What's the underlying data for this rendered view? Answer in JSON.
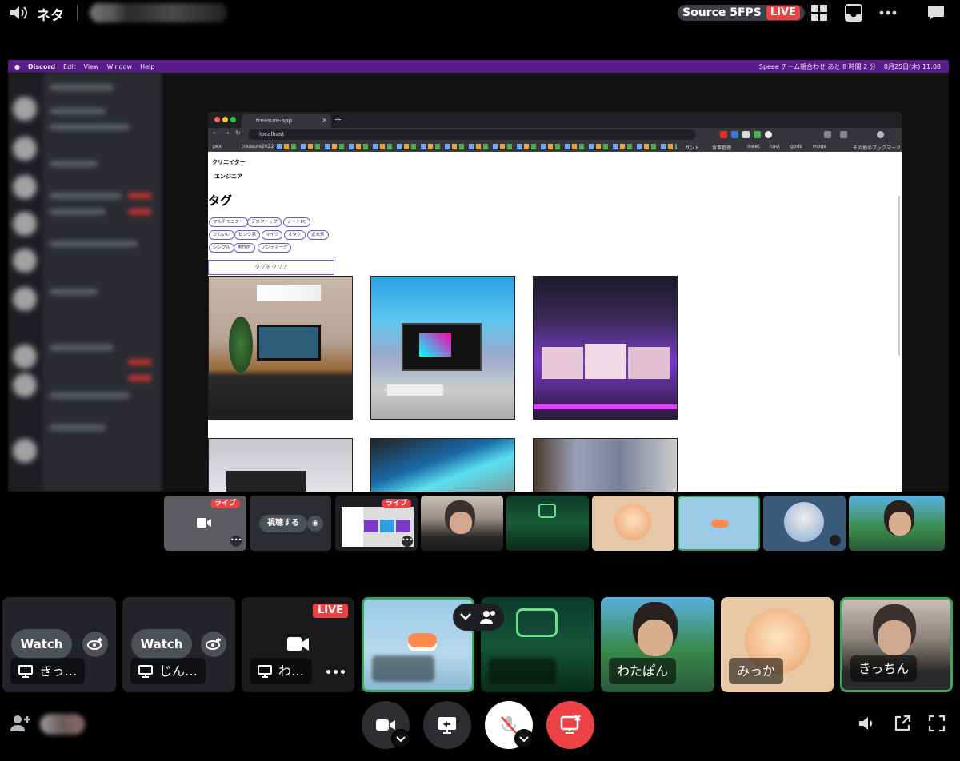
{
  "topbar": {
    "channel": "ネタ",
    "stream_quality": "Source 5FPS",
    "live_label": "LIVE"
  },
  "mac_menu": {
    "items": [
      "Discord",
      "Edit",
      "View",
      "Window",
      "Help"
    ],
    "status": "Speee チーム親合わせ あと 8 時間 2 分",
    "datetime": "8月25日(木) 11:08"
  },
  "browser": {
    "tab_title": "treasure-app",
    "url": "localhost",
    "bookmarks": [
      "pex",
      "treasure2022",
      "ガント",
      "食事管理",
      "meet",
      "navi",
      "gods",
      "mogs",
      "その他のブックマーク"
    ],
    "page": {
      "roles": [
        "クリエイター",
        "エンジニア"
      ],
      "tag_heading": "タグ",
      "tags": [
        [
          "マルチモニター",
          "デスクトップ",
          "ノートPC"
        ],
        [
          "かわいい",
          "ピンク系",
          "マイク",
          "オタク",
          "近未来"
        ],
        [
          "シンプル",
          "男性的",
          "アンティーク"
        ]
      ],
      "clear_button": "タグをクリア"
    }
  },
  "strip": {
    "live_label": "ライブ",
    "watch_label": "視聴する"
  },
  "tiles": [
    {
      "watch": "Watch",
      "name": "きっ…"
    },
    {
      "watch": "Watch",
      "name": "じん…"
    },
    {
      "live": "LIVE",
      "name": "わ…"
    },
    {
      "name": ""
    },
    {
      "name": ""
    },
    {
      "name": "わたぽん"
    },
    {
      "name": "みっか"
    },
    {
      "name": "きっちん"
    }
  ],
  "colors": {
    "live_red": "#ed4245",
    "speaking_green": "#3ba55d",
    "hangup_red": "#ed4245"
  }
}
